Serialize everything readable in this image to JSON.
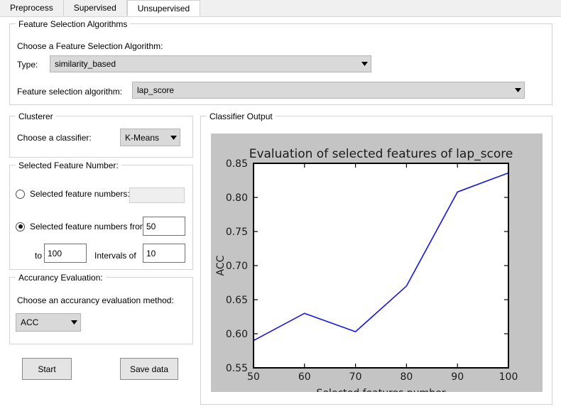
{
  "tabs": [
    {
      "label": "Preprocess",
      "active": false
    },
    {
      "label": "Supervised",
      "active": false
    },
    {
      "label": "Unsupervised",
      "active": true
    }
  ],
  "feature_selection_group": {
    "title": "Feature Selection Algorithms",
    "choose_label": "Choose a Feature Selection Algorithm:",
    "type_label": "Type:",
    "type_value": "similarity_based",
    "algorithm_label": "Feature selection algorithm:",
    "algorithm_value": "lap_score"
  },
  "clusterer_group": {
    "title": "Clusterer",
    "choose_label": "Choose a classifier:",
    "classifier_value": "K-Means"
  },
  "feature_number_group": {
    "title": "Selected Feature Number:",
    "option_single_label": "Selected feature numbers:",
    "option_single_value": "",
    "option_single_selected": false,
    "option_range_label": "Selected feature numbers from",
    "option_range_selected": true,
    "from_value": "50",
    "to_label": "to",
    "to_value": "100",
    "intervals_label": "Intervals of",
    "intervals_value": "10"
  },
  "accuracy_group": {
    "title": "Accurancy Evaluation:",
    "choose_label": "Choose an accurancy evaluation method:",
    "method_value": "ACC"
  },
  "actions": {
    "start_label": "Start",
    "save_label": "Save data"
  },
  "classifier_output": {
    "title": "Classifier Output"
  },
  "icons": {
    "chevron_down": "chevron-down-icon"
  },
  "colors": {
    "line": "#1414E6",
    "chart_background": "#c4c4c4",
    "plot_background": "#ffffff",
    "axis": "#000000"
  },
  "chart_data": {
    "type": "line",
    "title": "Evaluation of selected features of lap_score",
    "xlabel": "Selected features number",
    "ylabel": "ACC",
    "x": [
      50,
      60,
      70,
      80,
      90,
      100
    ],
    "values": [
      0.59,
      0.63,
      0.603,
      0.67,
      0.808,
      0.836
    ],
    "xticks": [
      50,
      60,
      70,
      80,
      90,
      100
    ],
    "yticks": [
      0.55,
      0.6,
      0.65,
      0.7,
      0.75,
      0.8,
      0.85
    ],
    "ytick_labels": [
      "0.55",
      "0.60",
      "0.65",
      "0.70",
      "0.75",
      "0.80",
      "0.85"
    ],
    "xtick_labels": [
      "50",
      "60",
      "70",
      "80",
      "90",
      "100"
    ],
    "xlim": [
      50,
      100
    ],
    "ylim": [
      0.55,
      0.85
    ],
    "grid": false,
    "legend": false
  }
}
